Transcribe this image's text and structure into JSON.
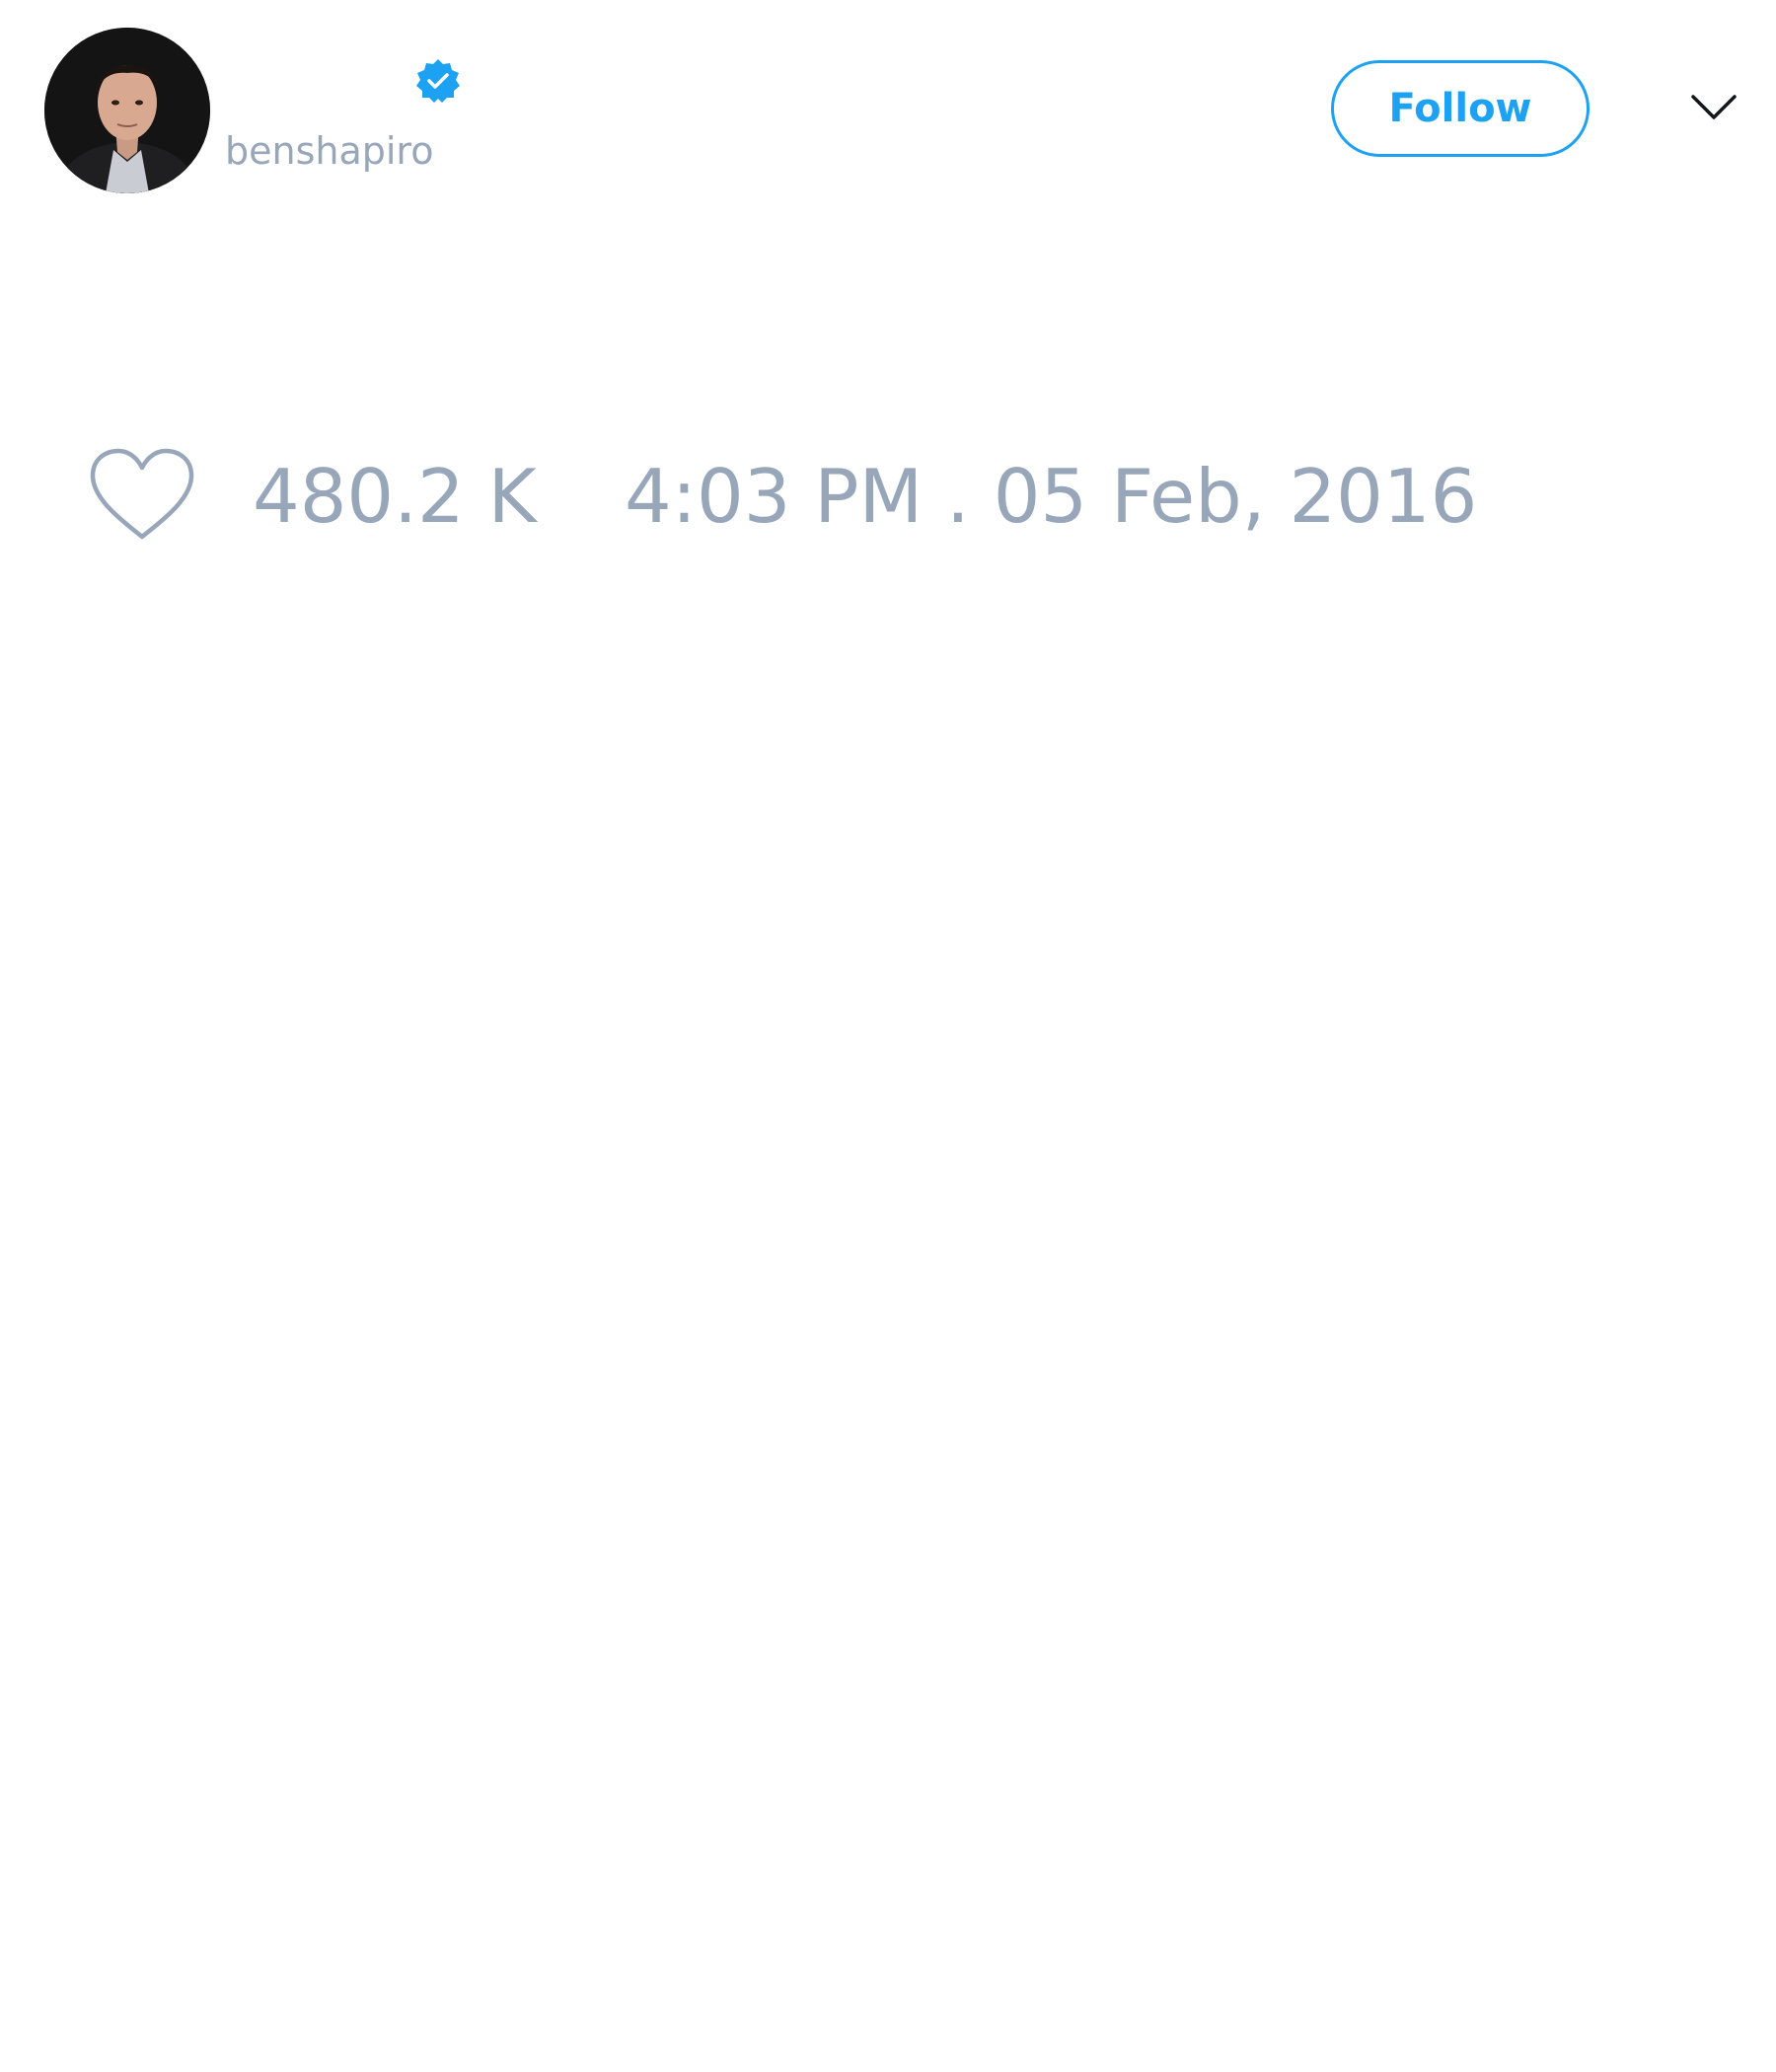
{
  "author": {
    "display_name": "",
    "handle": "benshapiro",
    "verified": true,
    "avatar_icon": "user-avatar-photo"
  },
  "actions": {
    "follow_label": "Follow",
    "menu_icon": "chevron-down-icon"
  },
  "stats": {
    "like_icon": "heart-outline-icon",
    "like_count": "480.2 K",
    "timestamp": "4:03 PM . 05 Feb, 2016"
  },
  "colors": {
    "accent": "#1da1f2",
    "muted_text": "#98a6b9",
    "icon_stroke": "#98a6b9"
  }
}
